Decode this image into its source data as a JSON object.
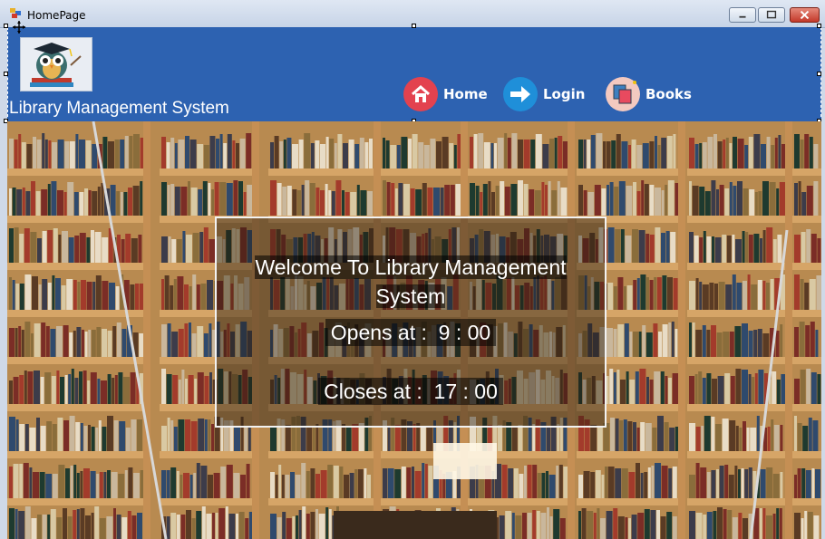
{
  "window": {
    "title": "HomePage"
  },
  "header": {
    "app_title": "Library Management System",
    "nav": [
      {
        "label": "Home",
        "icon": "home-icon",
        "color": "#e3424f"
      },
      {
        "label": "Login",
        "icon": "arrow-right-icon",
        "color": "#1f8fd9"
      },
      {
        "label": "Books",
        "icon": "books-icon",
        "color": "#f3c9c0"
      }
    ]
  },
  "panel": {
    "welcome_line1": "Welcome To Library Management",
    "welcome_line2": "System",
    "opens_label": "Opens at :",
    "opens_time": "9 : 00",
    "closes_label": "Closes at :",
    "closes_time": "17 : 00"
  },
  "colors": {
    "header": "#2d62b1",
    "text": "#ffffff"
  }
}
